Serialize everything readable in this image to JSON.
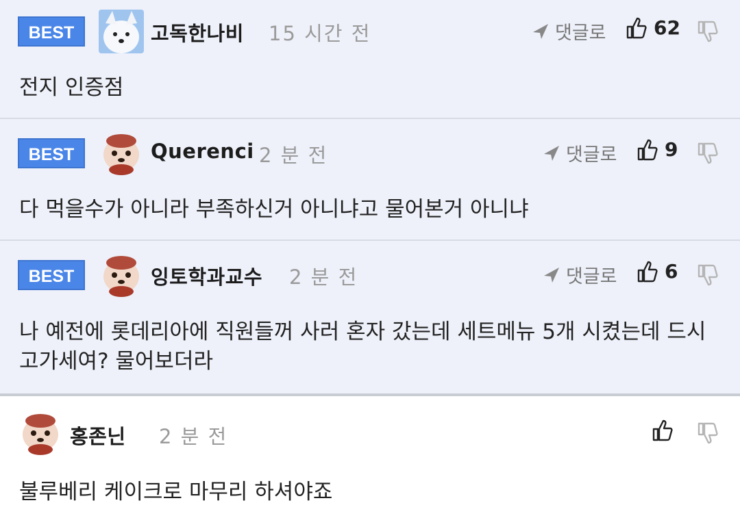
{
  "reply_label": "댓글로",
  "best_label": "BEST",
  "comments": [
    {
      "nick": "고독한나비",
      "time": "15 시간 전",
      "likes": "62",
      "text": "전지 인증점"
    },
    {
      "nick": "Querenci",
      "time": "2 분 전",
      "likes": "9",
      "text": "다 먹을수가 아니라 부족하신거 아니냐고 물어본거 아니냐"
    },
    {
      "nick": "잉토학과교수",
      "time": "2 분 전",
      "likes": "6",
      "text": "나 예전에 롯데리아에 직원들꺼 사러 혼자 갔는데 세트메뉴 5개 시켰는데 드시고가세여? 물어보더라"
    },
    {
      "nick": "홍존닌",
      "time": "2 분 전",
      "likes": "",
      "text": "불루베리 케이크로 마무리 하셔야죠"
    }
  ],
  "colors": {
    "best_bg": "#4a86e8",
    "best_area": "#eef1fa",
    "time": "#9a9a9a"
  }
}
